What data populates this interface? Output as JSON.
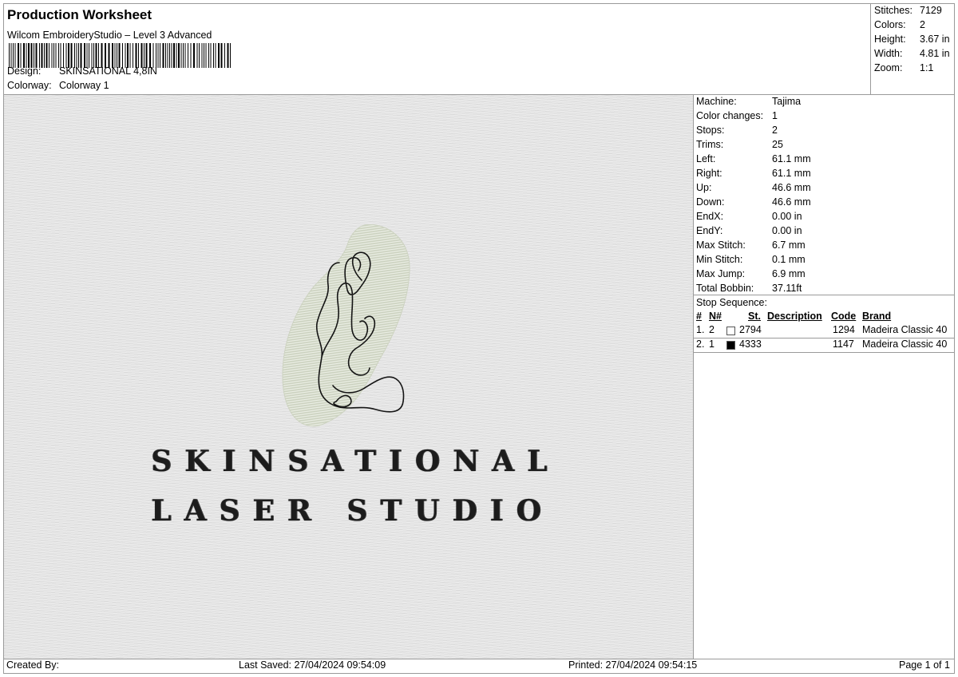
{
  "header": {
    "title": "Production Worksheet",
    "subtitle": "Wilcom EmbroideryStudio – Level 3 Advanced",
    "design_label": "Design:",
    "design_value": "SKINSATIONAL 4,8IN",
    "colorway_label": "Colorway:",
    "colorway_value": "Colorway 1"
  },
  "summary": [
    {
      "label": "Stitches:",
      "value": "7129"
    },
    {
      "label": "Colors:",
      "value": "2"
    },
    {
      "label": "Height:",
      "value": "3.67 in"
    },
    {
      "label": "Width:",
      "value": "4.81 in"
    },
    {
      "label": "Zoom:",
      "value": "1:1"
    }
  ],
  "preview": {
    "line1": "SKINSATIONAL",
    "line2": "LASER STUDIO",
    "leaf_color": "#d6dccb",
    "outline_color": "#151515"
  },
  "machine_info": [
    {
      "label": "Machine:",
      "value": "Tajima"
    },
    {
      "label": "Color changes:",
      "value": "1"
    },
    {
      "label": "Stops:",
      "value": "2"
    },
    {
      "label": "Trims:",
      "value": "25"
    },
    {
      "label": "Left:",
      "value": "61.1 mm"
    },
    {
      "label": "Right:",
      "value": "61.1 mm"
    },
    {
      "label": "Up:",
      "value": "46.6 mm"
    },
    {
      "label": "Down:",
      "value": "46.6 mm"
    },
    {
      "label": "EndX:",
      "value": "0.00 in"
    },
    {
      "label": "EndY:",
      "value": "0.00 in"
    },
    {
      "label": "Max Stitch:",
      "value": "6.7 mm"
    },
    {
      "label": "Min Stitch:",
      "value": "0.1 mm"
    },
    {
      "label": "Max Jump:",
      "value": "6.9 mm"
    },
    {
      "label": "Total Bobbin:",
      "value": "37.11ft"
    }
  ],
  "stop_sequence": {
    "title": "Stop Sequence:",
    "headers": {
      "idx": "#",
      "n": "N#",
      "st": "St.",
      "desc": "Description",
      "code": "Code",
      "brand": "Brand"
    },
    "rows": [
      {
        "idx": "1.",
        "n": "2",
        "swatch": "#ffffff",
        "st": "2794",
        "desc": "",
        "code": "1294",
        "brand": "Madeira Classic 40"
      },
      {
        "idx": "2.",
        "n": "1",
        "swatch": "#000000",
        "st": "4333",
        "desc": "",
        "code": "1147",
        "brand": "Madeira Classic 40"
      }
    ]
  },
  "footer": {
    "created_by": "Created By:",
    "last_saved": "Last Saved: 27/04/2024 09:54:09",
    "printed": "Printed: 27/04/2024 09:54:15",
    "page": "Page 1 of 1"
  }
}
